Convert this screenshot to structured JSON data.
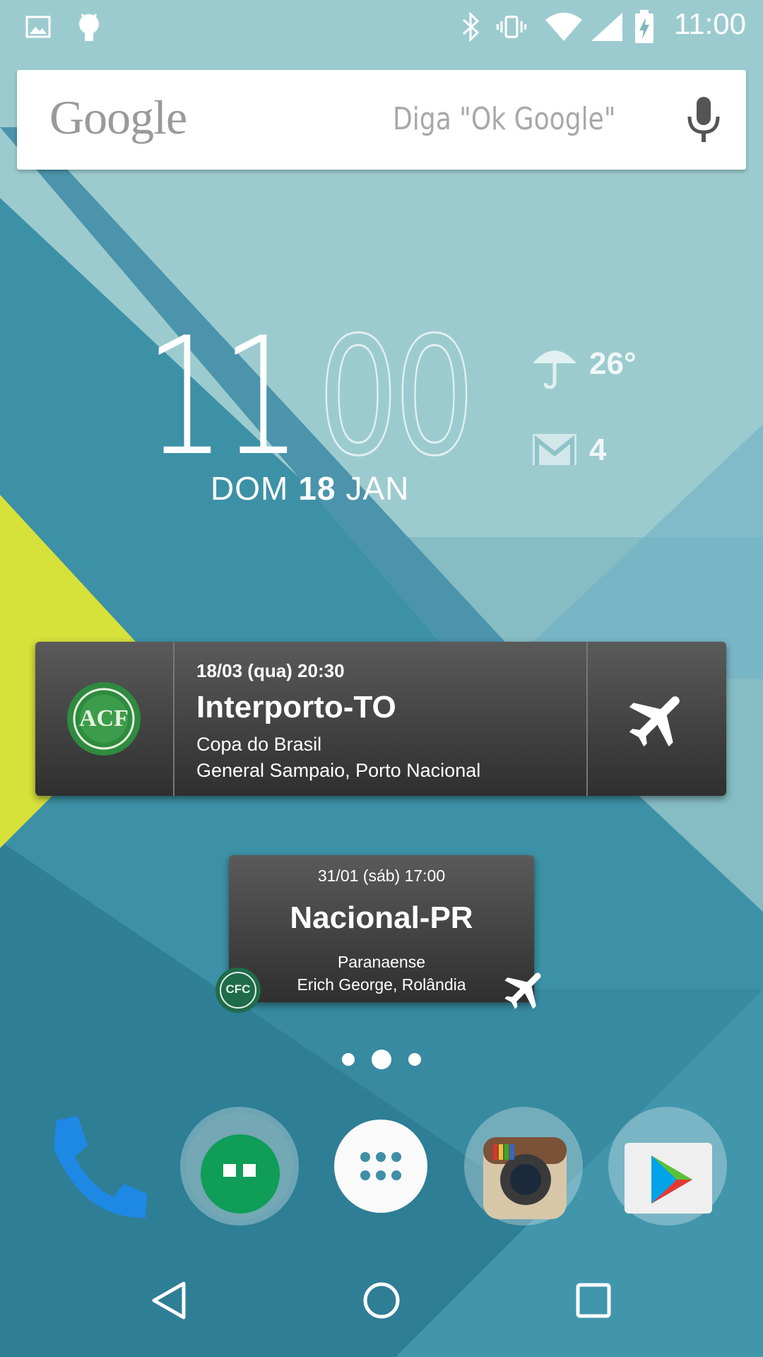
{
  "status_bar": {
    "time": "11:00",
    "icons": [
      "image-icon",
      "android-icon",
      "bluetooth-icon",
      "vibrate-icon",
      "wifi-icon",
      "signal-icon",
      "battery-charging-icon"
    ]
  },
  "search": {
    "logo": "Google",
    "hint": "Diga \"Ok Google\""
  },
  "clock_widget": {
    "hours": "11",
    "minutes": "00",
    "day": "DOM",
    "date": "18",
    "month": "JAN",
    "temperature": "26°",
    "unread_mail": "4"
  },
  "match_widget_large": {
    "datetime": "18/03 (qua) 20:30",
    "opponent": "Interporto-TO",
    "competition": "Copa do Brasil",
    "venue": "General Sampaio, Porto Nacional",
    "crest_text": "ACF",
    "crest_color": "#2e8b3f"
  },
  "match_widget_small": {
    "datetime": "31/01 (sáb) 17:00",
    "opponent": "Nacional-PR",
    "competition": "Paranaense",
    "venue": "Erich George, Rolândia",
    "crest_text": "CFC",
    "crest_color": "#1f6b4a"
  },
  "page_indicator": {
    "pages": 3,
    "current": 2
  },
  "dock": [
    "phone-icon",
    "hangouts-icon",
    "app-drawer-icon",
    "instagram-icon",
    "play-store-icon"
  ],
  "nav_bar": [
    "back-icon",
    "home-icon",
    "recents-icon"
  ],
  "colors": {
    "accent_teal": "#3a8fa9",
    "wallpaper_light": "#a7d2d4",
    "yellow": "#d8e23a"
  }
}
